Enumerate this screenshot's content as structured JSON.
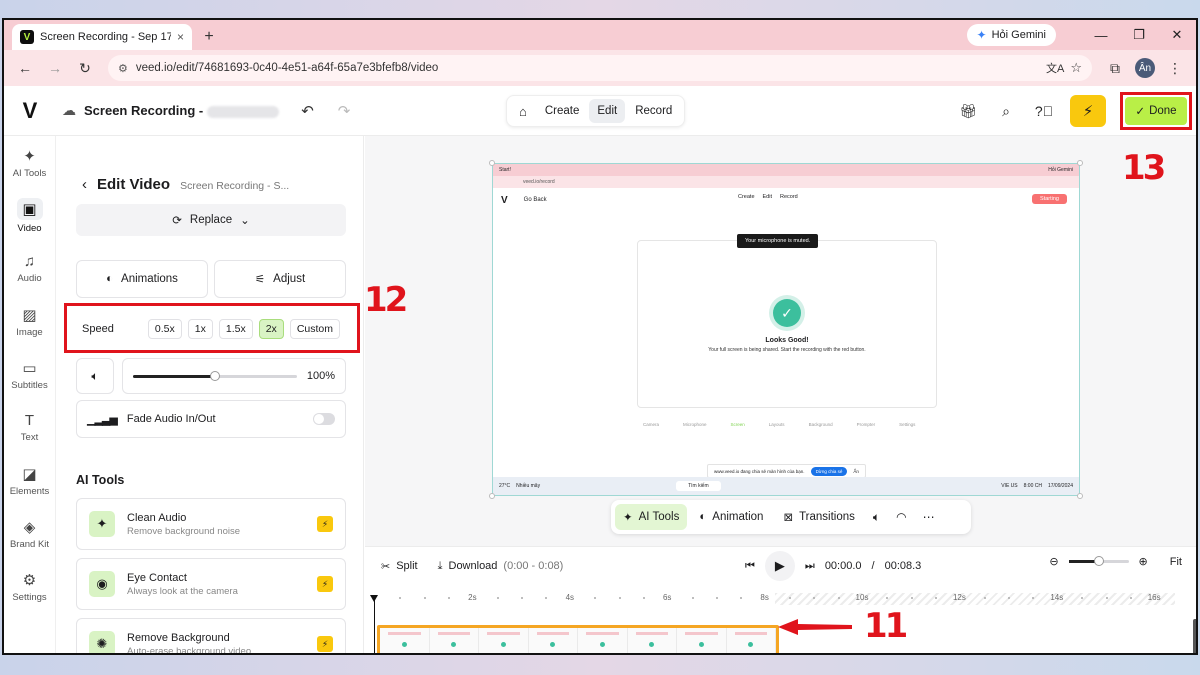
{
  "browser": {
    "tab_title": "Screen Recording - Sep 17, 202",
    "tab_close": "×",
    "new_tab": "+",
    "gemini_label": "Hỏi Gemini",
    "url": "veed.io/edit/74681693-0c40-4e51-a64f-65a7e3bfefb8/video",
    "avatar_initials": "Ân"
  },
  "header": {
    "logo": "V",
    "project_name": "Screen Recording -",
    "modes": [
      "Create",
      "Edit",
      "Record"
    ],
    "active_mode": "Edit",
    "done_label": "Done"
  },
  "rail": [
    {
      "label": "AI Tools",
      "icon": "sparkle-icon"
    },
    {
      "label": "Video",
      "icon": "video-icon",
      "active": true
    },
    {
      "label": "Audio",
      "icon": "music-icon"
    },
    {
      "label": "Image",
      "icon": "image-icon"
    },
    {
      "label": "Subtitles",
      "icon": "subtitles-icon"
    },
    {
      "label": "Text",
      "icon": "text-icon"
    },
    {
      "label": "Elements",
      "icon": "elements-icon"
    },
    {
      "label": "Brand Kit",
      "icon": "brand-kit-icon"
    },
    {
      "label": "Settings",
      "icon": "gear-icon"
    }
  ],
  "panel": {
    "title": "Edit Video",
    "subtitle": "Screen Recording - S...",
    "replace_label": "Replace",
    "animations_label": "Animations",
    "adjust_label": "Adjust",
    "speed_label": "Speed",
    "speed_options": [
      "0.5x",
      "1x",
      "1.5x",
      "2x",
      "Custom"
    ],
    "speed_selected": "2x",
    "volume_value": "100%",
    "volume_fraction": 0.5,
    "fade_label": "Fade Audio In/Out",
    "ai_heading": "AI Tools",
    "ai_tools": [
      {
        "title": "Clean Audio",
        "desc": "Remove background noise",
        "icon": "sparkle-icon"
      },
      {
        "title": "Eye Contact",
        "desc": "Always look at the camera",
        "icon": "eye-icon"
      },
      {
        "title": "Remove Background",
        "desc": "Auto-erase background video",
        "icon": "magic-icon"
      }
    ]
  },
  "preview": {
    "tab": "Start!",
    "gemini": "Hỏi Gemini",
    "url": "veed.io/record",
    "back": "Go Back",
    "modes": [
      "Create",
      "Edit",
      "Record"
    ],
    "starting": "Starting",
    "toast": "Your microphone is muted.",
    "good_title": "Looks Good!",
    "good_desc": "Your full screen is being shared. Start the recording with the red button.",
    "sources": [
      "Camera",
      "Microphone",
      "Screen",
      "Layouts",
      "Background",
      "Prompter",
      "Settings"
    ],
    "share_text": "www.veed.io đang chia sẻ màn hình của bạn.",
    "share_button": "Dừng chia sẻ",
    "share_hide": "Ẩn",
    "weather_temp": "27°C",
    "weather_desc": "Nhiều mây",
    "search": "Tìm kiếm",
    "lang": "VIE US",
    "time": "8:00 CH",
    "date": "17/09/2024"
  },
  "context_bar": {
    "ai_tools": "AI Tools",
    "animation": "Animation",
    "transitions": "Transitions",
    "more": "⋯"
  },
  "timeline": {
    "split": "Split",
    "download": "Download",
    "download_range": "(0:00 - 0:08)",
    "current_time": "00:00.0",
    "separator": "/",
    "total_time": "00:08.3",
    "fit": "Fit",
    "zoom_fraction": 0.5,
    "ticks": [
      "2s",
      "4s",
      "6s",
      "8s",
      "10s",
      "12s",
      "14s",
      "16s"
    ]
  },
  "annotations": {
    "speed_step": "12",
    "done_step": "13",
    "clip_step": "11"
  },
  "colors": {
    "accent_green": "#b9ef47",
    "highlight_red": "#e0141c",
    "bolt_yellow": "#f9c80e",
    "clip_orange": "#f5a623"
  }
}
